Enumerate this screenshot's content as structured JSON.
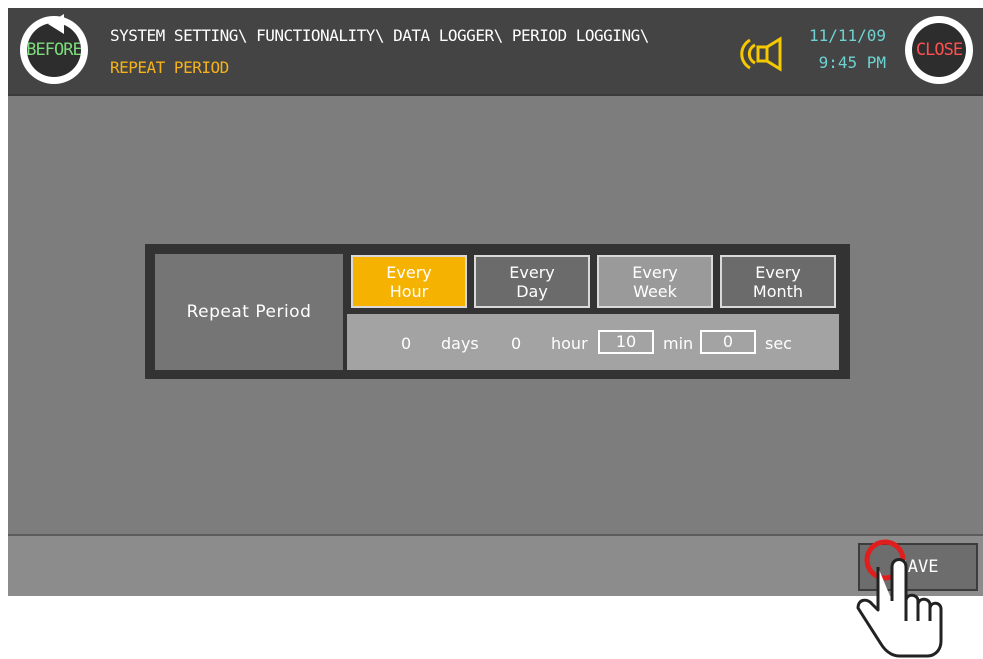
{
  "header": {
    "before_label": "BEFORE",
    "breadcrumb": "SYSTEM SETTING\\ FUNCTIONALITY\\ DATA LOGGER\\ PERIOD LOGGING\\",
    "subtitle": "REPEAT PERIOD",
    "date": "11/11/09",
    "time": "9:45 PM",
    "close_label": "CLOSE"
  },
  "repeat_period": {
    "label": "Repeat Period",
    "options": [
      {
        "line1": "Every",
        "line2": "Hour",
        "selected": true
      },
      {
        "line1": "Every",
        "line2": "Day",
        "selected": false
      },
      {
        "line1": "Every",
        "line2": "Week",
        "selected": false
      },
      {
        "line1": "Every",
        "line2": "Month",
        "selected": false
      }
    ],
    "days_value": "0",
    "days_unit": "days",
    "hour_value": "0",
    "hour_unit": "hour",
    "min_value": "10",
    "min_unit": "min",
    "sec_value": "0",
    "sec_unit": "sec"
  },
  "footer": {
    "save_label": "SAVE"
  },
  "colors": {
    "accent": "#f5b200",
    "background": "#7d7d7d",
    "header": "#444444",
    "clock": "#6fd2d2",
    "close": "#ff5050",
    "before": "#7cdc7c",
    "touch_indicator": "#e01e1e"
  },
  "icons": {
    "before": "undo-arrow-icon",
    "sound": "speaker-sound-icon",
    "touch": "pointing-hand-icon"
  }
}
